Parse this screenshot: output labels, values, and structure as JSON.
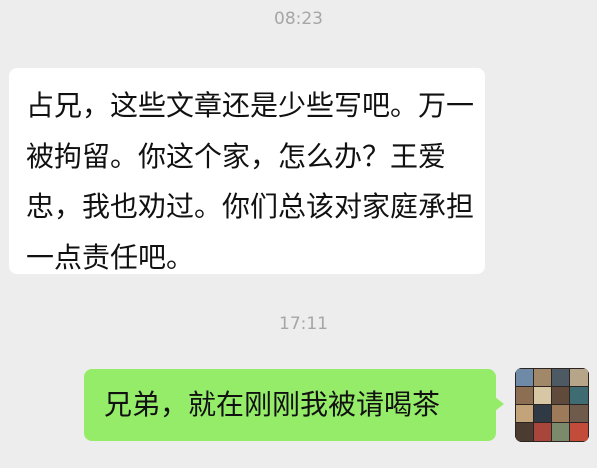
{
  "chat": {
    "messages": [
      {
        "timestamp": "08:23",
        "direction": "incoming",
        "text": "占兄，这些文章还是少些写吧。万一被拘留。你这个家，怎么办？王爱忠，我也劝过。你们总该对家庭承担一点责任吧。"
      },
      {
        "timestamp": "17:11",
        "direction": "outgoing",
        "text": "兄弟，就在刚刚我被请喝茶"
      }
    ]
  },
  "colors": {
    "background": "#ededed",
    "incoming_bubble": "#ffffff",
    "outgoing_bubble": "#95ec69",
    "timestamp_text": "#a6a6a6",
    "message_text": "#111111"
  },
  "icons": {
    "avatar": "photo-collage-avatar"
  }
}
